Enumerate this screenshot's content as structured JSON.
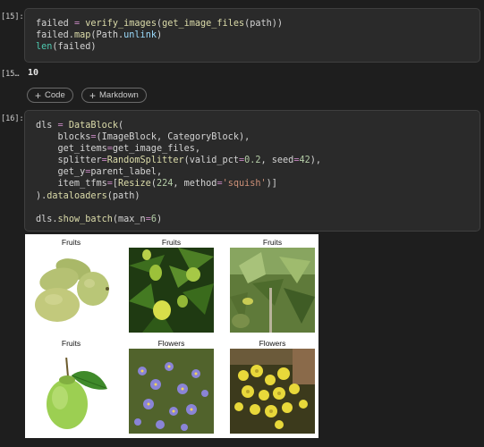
{
  "cells": [
    {
      "prompt": "[15]:",
      "code_lines": [
        "failed = verify_images(get_image_files(path))",
        "failed.map(Path.unlink)",
        "len(failed)"
      ]
    },
    {
      "prompt": "[16]:",
      "code_lines": [
        "dls = DataBlock(",
        "    blocks=(ImageBlock, CategoryBlock),",
        "    get_items=get_image_files,",
        "    splitter=RandomSplitter(valid_pct=0.2, seed=42),",
        "    get_y=parent_label,",
        "    item_tfms=[Resize(224, method='squish')]",
        ").dataloaders(path)",
        "",
        "dls.show_batch(max_n=6)"
      ]
    }
  ],
  "output_15": {
    "prompt": "[15…",
    "value": "10"
  },
  "toolbar": {
    "add_code": "Code",
    "add_markdown": "Markdown"
  },
  "batch": [
    {
      "label": "Fruits",
      "icon": "guavas-photo"
    },
    {
      "label": "Fruits",
      "icon": "lime-tree-photo"
    },
    {
      "label": "Fruits",
      "icon": "plant-photo"
    },
    {
      "label": "Fruits",
      "icon": "guava-with-leaf-photo"
    },
    {
      "label": "Flowers",
      "icon": "purple-flowers-photo"
    },
    {
      "label": "Flowers",
      "icon": "yellow-flowers-photo"
    }
  ],
  "colors": {
    "background": "#1e1e1e",
    "cell": "#2a2a2a",
    "keyword": "#c586c0",
    "function": "#dcdcaa",
    "number": "#b5cea8",
    "string": "#ce9178"
  }
}
